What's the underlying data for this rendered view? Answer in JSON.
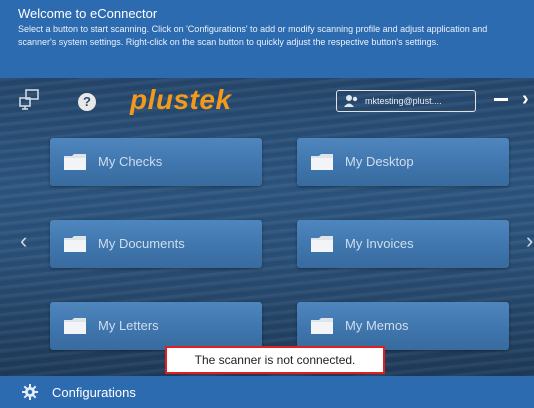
{
  "welcome": {
    "title": "Welcome to  eConnector",
    "description": "Select a button to start scanning.  Click on 'Configurations' to add or modify scanning profile and adjust application and scanner's system settings.  Right-click on the scan button to quickly adjust the respective button's settings."
  },
  "toolbar": {
    "network_icon": "network-icon",
    "help_icon": "help-icon",
    "help_symbol": "?",
    "logo": "plustek",
    "user_display": "mktesting@plust....",
    "minimize_symbol": "—",
    "next_symbol": "›"
  },
  "nav": {
    "prev_symbol": "‹",
    "next_symbol": "›"
  },
  "tiles": [
    {
      "label": "My Checks"
    },
    {
      "label": "My Desktop"
    },
    {
      "label": "My Documents"
    },
    {
      "label": "My Invoices"
    },
    {
      "label": "My Letters"
    },
    {
      "label": "My Memos"
    }
  ],
  "status": {
    "message": "The scanner is not connected."
  },
  "footer": {
    "configurations_label": "Configurations"
  },
  "colors": {
    "header_bg": "#2d6bb1",
    "tile_bg": "#4178ae",
    "logo": "#f39a1a",
    "status_border": "#e02020"
  }
}
